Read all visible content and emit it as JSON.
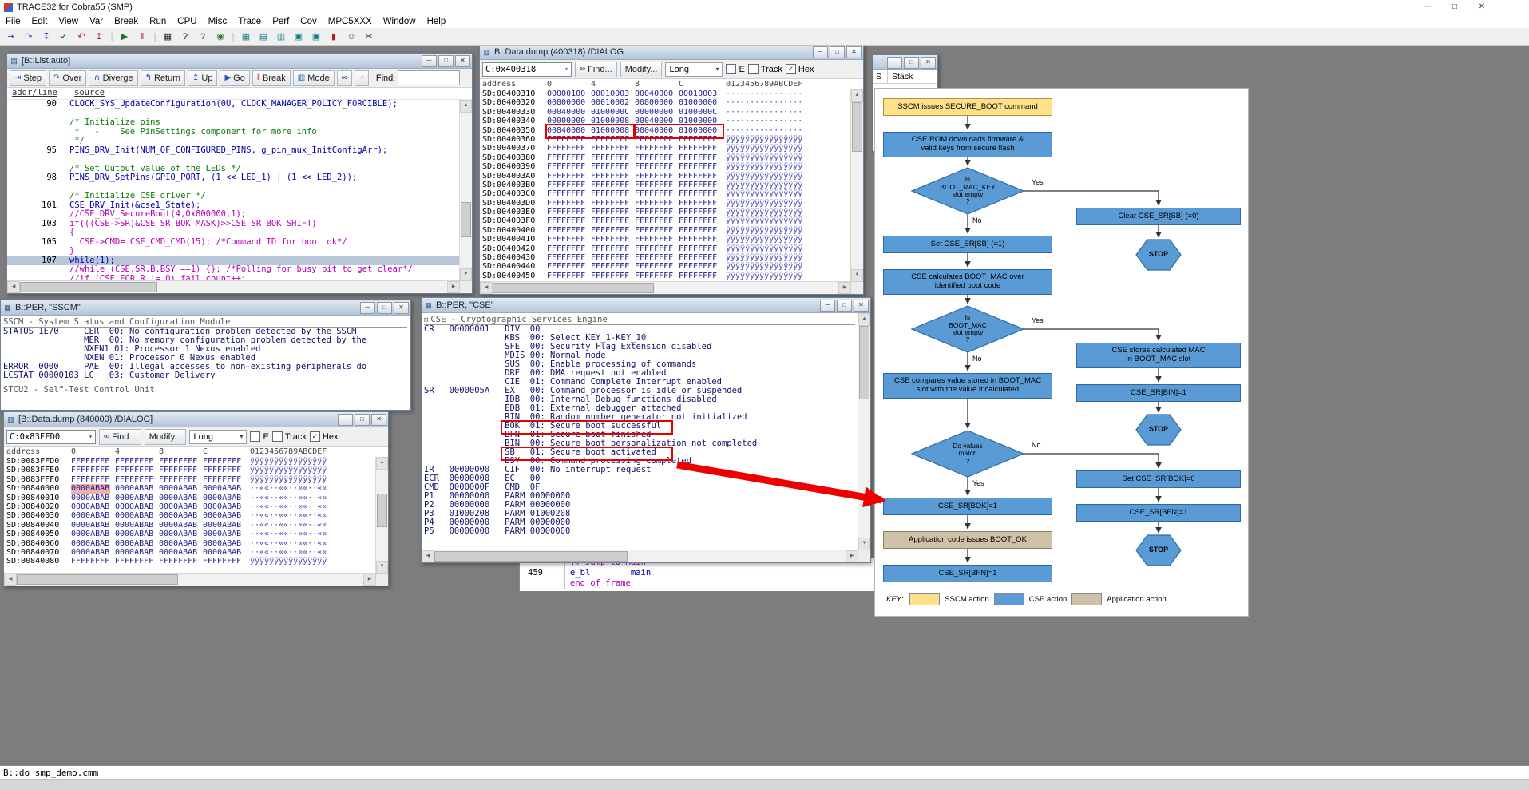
{
  "app": {
    "title": "TRACE32 for Cobra55 (SMP)",
    "cmdline": "B::do smp_demo.cmm",
    "check": "✓",
    "arrow": "▾",
    "expander": "⊟",
    "find_icon": "∞",
    "menu": [
      "File",
      "Edit",
      "View",
      "Var",
      "Break",
      "Run",
      "CPU",
      "Misc",
      "Trace",
      "Perf",
      "Cov",
      "MPC5XXX",
      "Window",
      "Help"
    ],
    "toolbar": [
      {
        "n": "step-icon",
        "g": "⇥",
        "c": "tb-blue"
      },
      {
        "n": "step-over-icon",
        "g": "↷",
        "c": "tb-blue"
      },
      {
        "n": "step-down-icon",
        "g": "↧",
        "c": "tb-blue"
      },
      {
        "n": "ok-icon",
        "g": "✓",
        "c": "tb-dark"
      },
      {
        "n": "undo-icon",
        "g": "↶",
        "c": "tb-red"
      },
      {
        "n": "up-icon",
        "g": "↥",
        "c": "tb-red"
      },
      {
        "n": "separator",
        "g": "|",
        "c": "tsep"
      },
      {
        "n": "go-icon",
        "g": "▶",
        "c": "tb-green"
      },
      {
        "n": "break-icon",
        "g": "‖",
        "c": "tb-red"
      },
      {
        "n": "separator",
        "g": "|",
        "c": "tsep"
      },
      {
        "n": "grid-icon",
        "g": "▦",
        "c": "tb-dark"
      },
      {
        "n": "help-icon",
        "g": "?",
        "c": "tb-dark"
      },
      {
        "n": "whatis-icon",
        "g": "?",
        "c": "tb-blue"
      },
      {
        "n": "world-icon",
        "g": "◉",
        "c": "tb-green"
      },
      {
        "n": "separator",
        "g": "|",
        "c": "tsep"
      },
      {
        "n": "dump-icon",
        "g": "▦",
        "c": "tb-teal"
      },
      {
        "n": "list-icon",
        "g": "▤",
        "c": "tb-teal"
      },
      {
        "n": "registers-icon",
        "g": "▥",
        "c": "tb-teal"
      },
      {
        "n": "chip-icon",
        "g": "▣",
        "c": "tb-teal"
      },
      {
        "n": "chip2-icon",
        "g": "▣",
        "c": "tb-teal"
      },
      {
        "n": "flash-icon",
        "g": "▮",
        "c": "tb-red"
      },
      {
        "n": "user-icon",
        "g": "☺",
        "c": "tb-blue"
      },
      {
        "n": "tools-icon",
        "g": "✂",
        "c": "tb-dark"
      }
    ],
    "winbtn": {
      "min": "─",
      "max": "□",
      "close": "✕"
    },
    "sb": {
      "up": "▲",
      "down": "▼",
      "left": "◀",
      "right": "▶"
    },
    "icons": {
      "list": "▤",
      "dump": "▥",
      "per": "▦"
    }
  },
  "colors": {
    "flow_blue": "#5b9bd5",
    "flow_yellow": "#ffe18c",
    "flow_tan": "#cfc0a8",
    "highlight_red": "#e60000"
  },
  "list": {
    "title": "[B::List.auto]",
    "buttons": [
      {
        "n": "step-button",
        "g": "⇥",
        "gc": "g-blue",
        "l": "Step"
      },
      {
        "n": "over-button",
        "g": "↷",
        "gc": "g-blue",
        "l": "Over"
      },
      {
        "n": "diverge-button",
        "g": "⋔",
        "gc": "g-blue",
        "l": "Diverge"
      },
      {
        "n": "return-button",
        "g": "↰",
        "gc": "g-blue",
        "l": "Return"
      },
      {
        "n": "up-button",
        "g": "↥",
        "gc": "g-blue",
        "l": "Up"
      },
      {
        "n": "go-button",
        "g": "▶",
        "gc": "g-blue",
        "l": "Go"
      },
      {
        "n": "break-button",
        "g": "‖",
        "gc": "g-red",
        "l": "Break"
      },
      {
        "n": "mode-button",
        "g": "▥",
        "gc": "g-blue",
        "l": "Mode"
      }
    ],
    "extra": [
      {
        "n": "glasses-icon",
        "g": "∞"
      },
      {
        "n": "stopwatch-icon",
        "g": "◔"
      }
    ],
    "find_label": "Find:",
    "header": {
      "addr": "addr/line",
      "src": "source"
    },
    "lines": [
      {
        "n": "90",
        "s": "CLOCK_SYS_UpdateConfiguration(0U, CLOCK_MANAGER_POLICY_FORCIBLE);",
        "c": "c-k"
      },
      {
        "n": "",
        "s": "",
        "c": ""
      },
      {
        "n": "",
        "s": "/* Initialize pins",
        "c": "c-g"
      },
      {
        "n": "",
        "s": " *   -    See PinSettings component for more info",
        "c": "c-g"
      },
      {
        "n": "",
        "s": " */",
        "c": "c-g"
      },
      {
        "n": "95",
        "s": "PINS_DRV_Init(NUM_OF_CONFIGURED_PINS, g_pin_mux_InitConfigArr);",
        "c": "c-k"
      },
      {
        "n": "",
        "s": "",
        "c": ""
      },
      {
        "n": "",
        "s": "/* Set Output value of the LEDs */",
        "c": "c-g"
      },
      {
        "n": "98",
        "s": "PINS_DRV_SetPins(GPIO_PORT, (1 << LED_1) | (1 << LED_2));",
        "c": "c-k"
      },
      {
        "n": "",
        "s": "",
        "c": ""
      },
      {
        "n": "",
        "s": "/* Initialize CSE driver */",
        "c": "c-g"
      },
      {
        "n": "101",
        "s": "CSE_DRV_Init(&cse1_State);",
        "c": "c-k"
      },
      {
        "n": "",
        "s": "//CSE_DRV_SecureBoot(4,0x800000,1);",
        "c": "c-m"
      },
      {
        "n": "103",
        "s": "if(((CSE->SR)&CSE_SR_BOK_MASK)>>CSE_SR_BOK_SHIFT)",
        "c": "c-m"
      },
      {
        "n": "",
        "s": "{",
        "c": "c-m"
      },
      {
        "n": "105",
        "s": "  CSE->CMD= CSE_CMD_CMD(15); /*Command ID for boot ok*/",
        "c": "c-m"
      },
      {
        "n": "",
        "s": "}",
        "c": "c-m"
      },
      {
        "n": "107",
        "s": "while(1);",
        "c": "c-k cur"
      },
      {
        "n": "",
        "s": "//while (CSE.SR.B.BSY ==1) {}; /*Polling for busy bit to get clear*/",
        "c": "c-m"
      },
      {
        "n": "",
        "s": "//if (CSE.ECR.R != 0) fail_count++;",
        "c": "c-m"
      }
    ]
  },
  "dump1": {
    "title": "B::Data.dump (400318) /DIALOG",
    "address": "C:0x400318",
    "find_label": "Find...",
    "modify_label": "Modify...",
    "size_label": "Long",
    "cb": {
      "e": "E",
      "track": "Track",
      "hex": "Hex"
    },
    "header": {
      "a": "address",
      "v": [
        "0",
        "4",
        "8",
        "C"
      ],
      "x": "0123456789ABCDEF"
    },
    "rows": [
      {
        "a": "SD:00400310",
        "v": [
          "00000100",
          "00010003",
          "00040000",
          "00010003"
        ],
        "x": "················",
        "c0": ""
      },
      {
        "a": "SD:00400320",
        "v": [
          "00800000",
          "00010002",
          "00800000",
          "01000000"
        ],
        "x": "················",
        "c0": ""
      },
      {
        "a": "SD:00400330",
        "v": [
          "00040000",
          "0100000C",
          "00000000",
          "0100000C"
        ],
        "x": "················",
        "c0": ""
      },
      {
        "a": "SD:00400340",
        "v": [
          "00000000",
          "01000008",
          "00040000",
          "01000000"
        ],
        "x": "················",
        "c0": ""
      },
      {
        "a": "SD:00400350",
        "v": [
          "00840000",
          "01000008",
          "00040000",
          "01000000"
        ],
        "x": "················",
        "c0": ""
      },
      {
        "a": "SD:00400360",
        "v": [
          "FFFFFFFF",
          "FFFFFFFF",
          "FFFFFFFF",
          "FFFFFFFF"
        ],
        "x": "ÿÿÿÿÿÿÿÿÿÿÿÿÿÿÿÿ",
        "c0": ""
      },
      {
        "a": "SD:00400370",
        "v": [
          "FFFFFFFF",
          "FFFFFFFF",
          "FFFFFFFF",
          "FFFFFFFF"
        ],
        "x": "ÿÿÿÿÿÿÿÿÿÿÿÿÿÿÿÿ",
        "c0": ""
      },
      {
        "a": "SD:00400380",
        "v": [
          "FFFFFFFF",
          "FFFFFFFF",
          "FFFFFFFF",
          "FFFFFFFF"
        ],
        "x": "ÿÿÿÿÿÿÿÿÿÿÿÿÿÿÿÿ",
        "c0": ""
      },
      {
        "a": "SD:00400390",
        "v": [
          "FFFFFFFF",
          "FFFFFFFF",
          "FFFFFFFF",
          "FFFFFFFF"
        ],
        "x": "ÿÿÿÿÿÿÿÿÿÿÿÿÿÿÿÿ",
        "c0": ""
      },
      {
        "a": "SD:004003A0",
        "v": [
          "FFFFFFFF",
          "FFFFFFFF",
          "FFFFFFFF",
          "FFFFFFFF"
        ],
        "x": "ÿÿÿÿÿÿÿÿÿÿÿÿÿÿÿÿ",
        "c0": ""
      },
      {
        "a": "SD:004003B0",
        "v": [
          "FFFFFFFF",
          "FFFFFFFF",
          "FFFFFFFF",
          "FFFFFFFF"
        ],
        "x": "ÿÿÿÿÿÿÿÿÿÿÿÿÿÿÿÿ",
        "c0": ""
      },
      {
        "a": "SD:004003C0",
        "v": [
          "FFFFFFFF",
          "FFFFFFFF",
          "FFFFFFFF",
          "FFFFFFFF"
        ],
        "x": "ÿÿÿÿÿÿÿÿÿÿÿÿÿÿÿÿ",
        "c0": ""
      },
      {
        "a": "SD:004003D0",
        "v": [
          "FFFFFFFF",
          "FFFFFFFF",
          "FFFFFFFF",
          "FFFFFFFF"
        ],
        "x": "ÿÿÿÿÿÿÿÿÿÿÿÿÿÿÿÿ",
        "c0": ""
      },
      {
        "a": "SD:004003E0",
        "v": [
          "FFFFFFFF",
          "FFFFFFFF",
          "FFFFFFFF",
          "FFFFFFFF"
        ],
        "x": "ÿÿÿÿÿÿÿÿÿÿÿÿÿÿÿÿ",
        "c0": ""
      },
      {
        "a": "SD:004003F0",
        "v": [
          "FFFFFFFF",
          "FFFFFFFF",
          "FFFFFFFF",
          "FFFFFFFF"
        ],
        "x": "ÿÿÿÿÿÿÿÿÿÿÿÿÿÿÿÿ",
        "c0": ""
      },
      {
        "a": "SD:00400400",
        "v": [
          "FFFFFFFF",
          "FFFFFFFF",
          "FFFFFFFF",
          "FFFFFFFF"
        ],
        "x": "ÿÿÿÿÿÿÿÿÿÿÿÿÿÿÿÿ",
        "c0": ""
      },
      {
        "a": "SD:00400410",
        "v": [
          "FFFFFFFF",
          "FFFFFFFF",
          "FFFFFFFF",
          "FFFFFFFF"
        ],
        "x": "ÿÿÿÿÿÿÿÿÿÿÿÿÿÿÿÿ",
        "c0": ""
      },
      {
        "a": "SD:00400420",
        "v": [
          "FFFFFFFF",
          "FFFFFFFF",
          "FFFFFFFF",
          "FFFFFFFF"
        ],
        "x": "ÿÿÿÿÿÿÿÿÿÿÿÿÿÿÿÿ",
        "c0": ""
      },
      {
        "a": "SD:00400430",
        "v": [
          "FFFFFFFF",
          "FFFFFFFF",
          "FFFFFFFF",
          "FFFFFFFF"
        ],
        "x": "ÿÿÿÿÿÿÿÿÿÿÿÿÿÿÿÿ",
        "c0": ""
      },
      {
        "a": "SD:00400440",
        "v": [
          "FFFFFFFF",
          "FFFFFFFF",
          "FFFFFFFF",
          "FFFFFFFF"
        ],
        "x": "ÿÿÿÿÿÿÿÿÿÿÿÿÿÿÿÿ",
        "c0": ""
      },
      {
        "a": "SD:00400450",
        "v": [
          "FFFFFFFF",
          "FFFFFFFF",
          "FFFFFFFF",
          "FFFFFFFF"
        ],
        "x": "ÿÿÿÿÿÿÿÿÿÿÿÿÿÿÿÿ",
        "c0": ""
      }
    ]
  },
  "dump2": {
    "title": "[B::Data.dump (840000) /DIALOG]",
    "address": "C:0x83FFD0",
    "find_label": "Find...",
    "modify_label": "Modify...",
    "size_label": "Long",
    "cb": {
      "e": "E",
      "track": "Track",
      "hex": "Hex"
    },
    "header": {
      "a": "address",
      "v": [
        "0",
        "4",
        "8",
        "C"
      ],
      "x": "0123456789ABCDEF"
    },
    "rows": [
      {
        "a": "SD:0083FFD0",
        "v": [
          "FFFFFFFF",
          "FFFFFFFF",
          "FFFFFFFF",
          "FFFFFFFF"
        ],
        "x": "ÿÿÿÿÿÿÿÿÿÿÿÿÿÿÿÿ",
        "c0": ""
      },
      {
        "a": "SD:0083FFE0",
        "v": [
          "FFFFFFFF",
          "FFFFFFFF",
          "FFFFFFFF",
          "FFFFFFFF"
        ],
        "x": "ÿÿÿÿÿÿÿÿÿÿÿÿÿÿÿÿ",
        "c0": ""
      },
      {
        "a": "SD:0083FFF0",
        "v": [
          "FFFFFFFF",
          "FFFFFFFF",
          "FFFFFFFF",
          "FFFFFFFF"
        ],
        "x": "ÿÿÿÿÿÿÿÿÿÿÿÿÿÿÿÿ",
        "c0": ""
      },
      {
        "a": "SD:00840000",
        "v": [
          "0000ABAB",
          "0000ABAB",
          "0000ABAB",
          "0000ABAB"
        ],
        "x": "··««··««··««··««",
        "c0": "hl"
      },
      {
        "a": "SD:00840010",
        "v": [
          "0000ABAB",
          "0000ABAB",
          "0000ABAB",
          "0000ABAB"
        ],
        "x": "··««··««··««··««",
        "c0": ""
      },
      {
        "a": "SD:00840020",
        "v": [
          "0000ABAB",
          "0000ABAB",
          "0000ABAB",
          "0000ABAB"
        ],
        "x": "··««··««··««··««",
        "c0": ""
      },
      {
        "a": "SD:00840030",
        "v": [
          "0000ABAB",
          "0000ABAB",
          "0000ABAB",
          "0000ABAB"
        ],
        "x": "··««··««··««··««",
        "c0": ""
      },
      {
        "a": "SD:00840040",
        "v": [
          "0000ABAB",
          "0000ABAB",
          "0000ABAB",
          "0000ABAB"
        ],
        "x": "··««··««··««··««",
        "c0": ""
      },
      {
        "a": "SD:00840050",
        "v": [
          "0000ABAB",
          "0000ABAB",
          "0000ABAB",
          "0000ABAB"
        ],
        "x": "··««··««··««··««",
        "c0": ""
      },
      {
        "a": "SD:00840060",
        "v": [
          "0000ABAB",
          "0000ABAB",
          "0000ABAB",
          "0000ABAB"
        ],
        "x": "··««··««··««··««",
        "c0": ""
      },
      {
        "a": "SD:00840070",
        "v": [
          "0000ABAB",
          "0000ABAB",
          "0000ABAB",
          "0000ABAB"
        ],
        "x": "··««··««··««··««",
        "c0": ""
      },
      {
        "a": "SD:00840080",
        "v": [
          "FFFFFFFF",
          "FFFFFFFF",
          "FFFFFFFF",
          "FFFFFFFF"
        ],
        "x": "ÿÿÿÿÿÿÿÿÿÿÿÿÿÿÿÿ",
        "c0": ""
      }
    ]
  },
  "sscm": {
    "title": "B::PER, \"SSCM\"",
    "header": "SSCM - System Status and Configuration Module",
    "lines": [
      "STATUS 1E70     CER  00: No configuration problem detected by the SSCM",
      "                MER  00: No memory configuration problem detected by the",
      "                NXEN1 01: Processor 1 Nexus enabled",
      "                NXEN 01: Processor 0 Nexus enabled",
      "ERROR  0000     PAE  00: Illegal accesses to non-existing peripherals do",
      "LCSTAT 00000103 LC   03: Customer Delivery"
    ],
    "header2": "STCU2 - Self-Test Control Unit"
  },
  "cse": {
    "title": "B::PER, \"CSE\"",
    "header": "CSE - Cryptographic Services Engine",
    "lines": [
      "CR   00000001   DIV  00",
      "                KBS  00: Select KEY_1-KEY_10",
      "                SFE  00: Security Flag Extension disabled",
      "                MDIS 00: Normal mode",
      "                SUS  00: Enable processing of commands",
      "                DRE  00: DMA request not enabled",
      "                CIE  01: Command Complete Interrupt enabled",
      "SR   0000005A   EX   00: Command processor is idle or suspended",
      "                IDB  00: Internal Debug functions disabled",
      "                EDB  01: External debugger attached",
      "                RIN  00: Random number generator not initialized",
      "                BOK  01: Secure boot successful",
      "                BFN  01: Secure boot finished",
      "                BIN  00: Secure boot personalization not completed",
      "                SB   01: Secure boot activated",
      "                BSY  00: Command processing completed",
      "IR   00000000   CIF  00: No interrupt request",
      "ECR  00000000   EC   00",
      "CMD  0000000F   CMD  0F",
      "P1   00000000   PARM 00000000",
      "P2   00000000   PARM 00000000",
      "P3   01000208   PARM 01000208",
      "P4   00000000   PARM 00000000",
      "P5   00000000   PARM 00000000"
    ]
  },
  "frame": {
    "lines": [
      {
        "n": "",
        "t": ";# Jump to Main",
        "c": "c-m"
      },
      {
        "n": "459",
        "t": "e_bl        main",
        "c": "c-k"
      },
      {
        "n": "",
        "t": "end of frame",
        "c": "c-m"
      }
    ]
  },
  "stack": {
    "cols": [
      "S",
      "Stack"
    ]
  },
  "flow": {
    "yes": "Yes",
    "no": "No",
    "stop": "STOP",
    "key_label": "KEY:",
    "nodes": {
      "sscm_cmd": "SSCM issues SECURE_BOOT command",
      "rom": "CSE ROM downloads firmware &\nvalid keys from secure flash",
      "d1": "Is\nBOOT_MAC_KEY\nslot empty\n?",
      "clear_sb": "Clear CSE_SR[SB] (=0)",
      "set_sb": "Set CSE_SR[SB] (=1)",
      "calc": "CSE calculates BOOT_MAC over\nidentified boot code",
      "d2": "Is\nBOOT_MAC\nslot empty\n?",
      "store": "CSE stores calculated MAC\nin BOOT_MAC slot",
      "bin": "CSE_SR[BIN]=1",
      "cmp": "CSE compares value stored in BOOT_MAC\nslot with the value it calculated",
      "d3": "Do values\nmatch\n?",
      "bok0": "Set CSE_SR[BOK]=0",
      "bfn_r": "CSE_SR[BFN]=1",
      "bok1": "CSE_SR[BOK]=1",
      "app": "Application code issues BOOT_OK",
      "bfn_l": "CSE_SR[BFN]=1"
    },
    "legend": [
      {
        "label": "SSCM action",
        "cls": "sw-yellow"
      },
      {
        "label": "CSE action",
        "cls": "sw-blue"
      },
      {
        "label": "Application action",
        "cls": "sw-tan"
      }
    ]
  }
}
